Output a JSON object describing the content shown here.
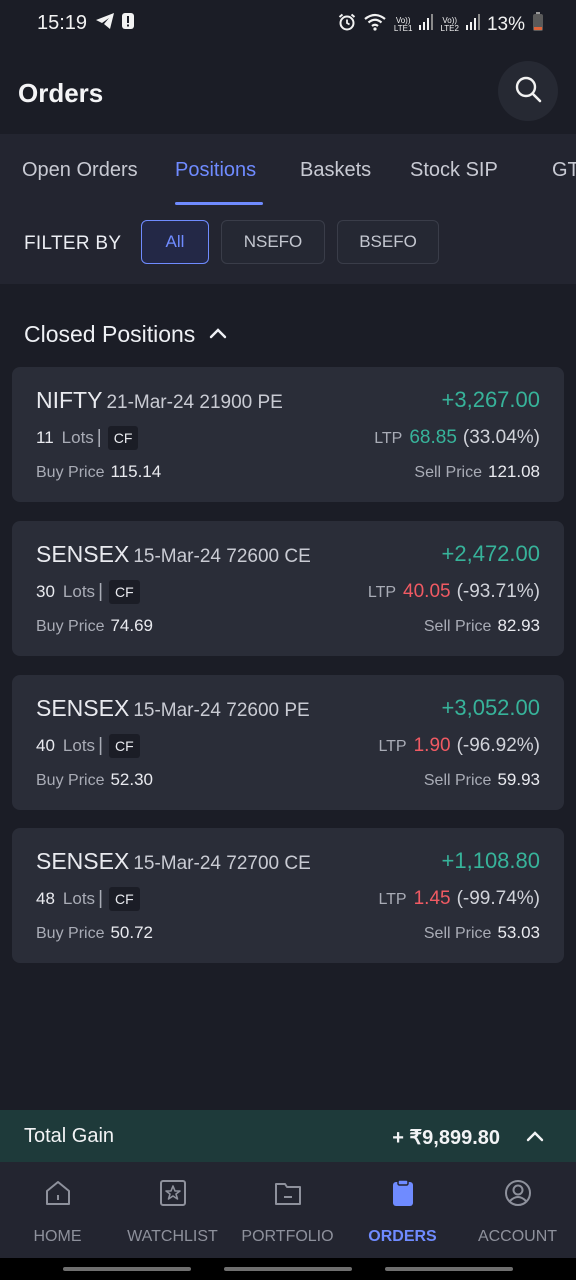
{
  "status": {
    "time": "15:19",
    "battery": "13%",
    "sim1": "LTE1",
    "sim2": "LTE2",
    "vo": "Vo))"
  },
  "header": {
    "title": "Orders"
  },
  "tabs": [
    {
      "label": "Open Orders"
    },
    {
      "label": "Positions",
      "active": true
    },
    {
      "label": "Baskets"
    },
    {
      "label": "Stock SIP"
    },
    {
      "label": "GT"
    }
  ],
  "filter": {
    "label": "FILTER BY",
    "options": [
      "All",
      "NSEFO",
      "BSEFO"
    ],
    "selected": "All"
  },
  "section": {
    "title": "Closed Positions"
  },
  "positions": [
    {
      "symbol": "NIFTY",
      "contract": "21-Mar-24 21900 PE",
      "pnl": "+3,267.00",
      "lots": "11",
      "lots_label": "Lots",
      "product": "CF",
      "ltp_label": "LTP",
      "ltp": "68.85",
      "change": "(33.04%)",
      "direction": "up",
      "buy_label": "Buy Price",
      "buy": "115.14",
      "sell_label": "Sell Price",
      "sell": "121.08"
    },
    {
      "symbol": "SENSEX",
      "contract": "15-Mar-24 72600 CE",
      "pnl": "+2,472.00",
      "lots": "30",
      "lots_label": "Lots",
      "product": "CF",
      "ltp_label": "LTP",
      "ltp": "40.05",
      "change": "(-93.71%)",
      "direction": "down",
      "buy_label": "Buy Price",
      "buy": "74.69",
      "sell_label": "Sell Price",
      "sell": "82.93"
    },
    {
      "symbol": "SENSEX",
      "contract": "15-Mar-24 72600 PE",
      "pnl": "+3,052.00",
      "lots": "40",
      "lots_label": "Lots",
      "product": "CF",
      "ltp_label": "LTP",
      "ltp": "1.90",
      "change": "(-96.92%)",
      "direction": "down",
      "buy_label": "Buy Price",
      "buy": "52.30",
      "sell_label": "Sell Price",
      "sell": "59.93"
    },
    {
      "symbol": "SENSEX",
      "contract": "15-Mar-24 72700 CE",
      "pnl": "+1,108.80",
      "lots": "48",
      "lots_label": "Lots",
      "product": "CF",
      "ltp_label": "LTP",
      "ltp": "1.45",
      "change": "(-99.74%)",
      "direction": "down",
      "buy_label": "Buy Price",
      "buy": "50.72",
      "sell_label": "Sell Price",
      "sell": "53.03"
    }
  ],
  "total": {
    "label": "Total Gain",
    "value": "+ ₹9,899.80"
  },
  "nav": [
    {
      "label": "HOME",
      "icon": "home-icon"
    },
    {
      "label": "WATCHLIST",
      "icon": "watchlist-icon"
    },
    {
      "label": "PORTFOLIO",
      "icon": "portfolio-icon"
    },
    {
      "label": "ORDERS",
      "icon": "orders-icon",
      "active": true
    },
    {
      "label": "ACCOUNT",
      "icon": "account-icon"
    }
  ],
  "colors": {
    "accent": "#6f8bff",
    "gain": "#37b39a",
    "loss": "#f05a63",
    "background": "#1b1d26",
    "card": "#2a2d38",
    "total_bar": "#1e3a3a"
  }
}
